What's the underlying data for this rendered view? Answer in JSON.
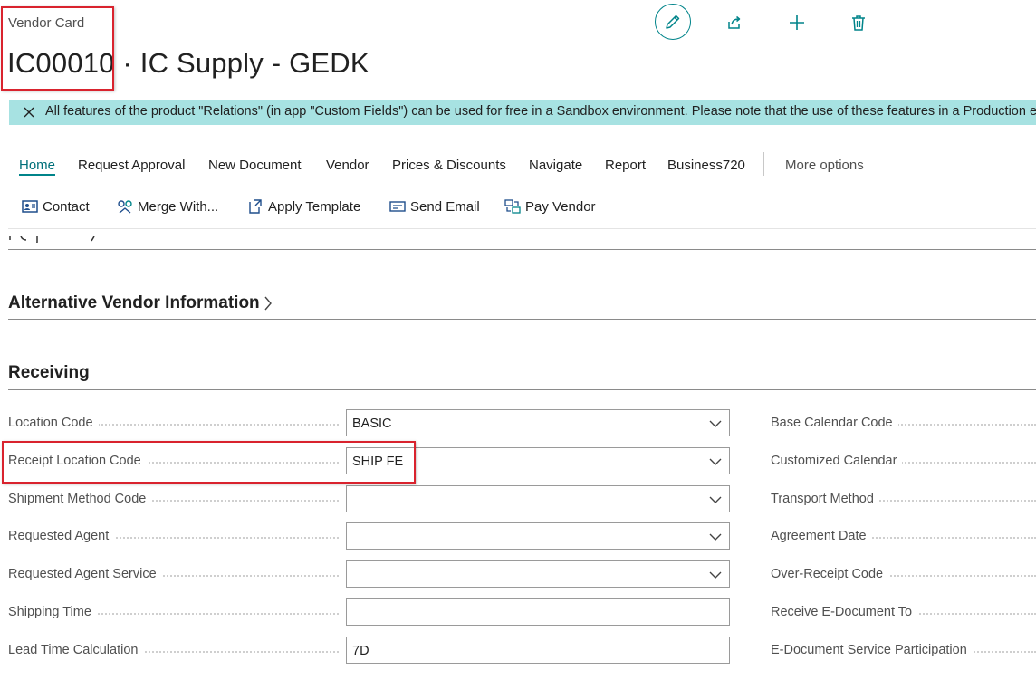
{
  "header": {
    "caption": "Vendor Card",
    "title": "IC00010 · IC Supply - GEDK"
  },
  "actions": {
    "edit": "pencil-icon",
    "share": "share-icon",
    "new": "plus-icon",
    "delete": "trash-icon"
  },
  "banner": {
    "text": "All features of the product \"Relations\" (in app \"Custom Fields\") can be used for free in a Sandbox environment. Please note that the use of these features in a Production environment requires a license."
  },
  "menu": {
    "items": [
      "Home",
      "Request Approval",
      "New Document",
      "Vendor",
      "Prices & Discounts",
      "Navigate",
      "Report",
      "Business720"
    ],
    "more": "More options",
    "active": "Home"
  },
  "action_bar": {
    "items": [
      "Contact",
      "Merge With...",
      "Apply Template",
      "Send Email",
      "Pay Vendor"
    ]
  },
  "sections": {
    "alt_vendor": "Alternative Vendor Information",
    "receiving": "Receiving"
  },
  "receiving": {
    "left_fields": [
      {
        "label": "Location Code",
        "value": "BASIC",
        "dropdown": true
      },
      {
        "label": "Receipt Location Code",
        "value": "SHIP FE",
        "dropdown": true
      },
      {
        "label": "Shipment Method Code",
        "value": "",
        "dropdown": true
      },
      {
        "label": "Requested Agent",
        "value": "",
        "dropdown": true
      },
      {
        "label": "Requested Agent Service",
        "value": "",
        "dropdown": true
      },
      {
        "label": "Shipping Time",
        "value": "",
        "dropdown": false
      },
      {
        "label": "Lead Time Calculation",
        "value": "7D",
        "dropdown": false
      }
    ],
    "right_fields": [
      "Base Calendar Code",
      "Customized Calendar",
      "Transport Method",
      "Agreement Date",
      "Over-Receipt Code",
      "Receive E-Document To",
      "E-Document Service Participation"
    ]
  },
  "colors": {
    "accent": "#00848a",
    "banner": "#a7e2e2",
    "highlight": "#d9232e"
  }
}
